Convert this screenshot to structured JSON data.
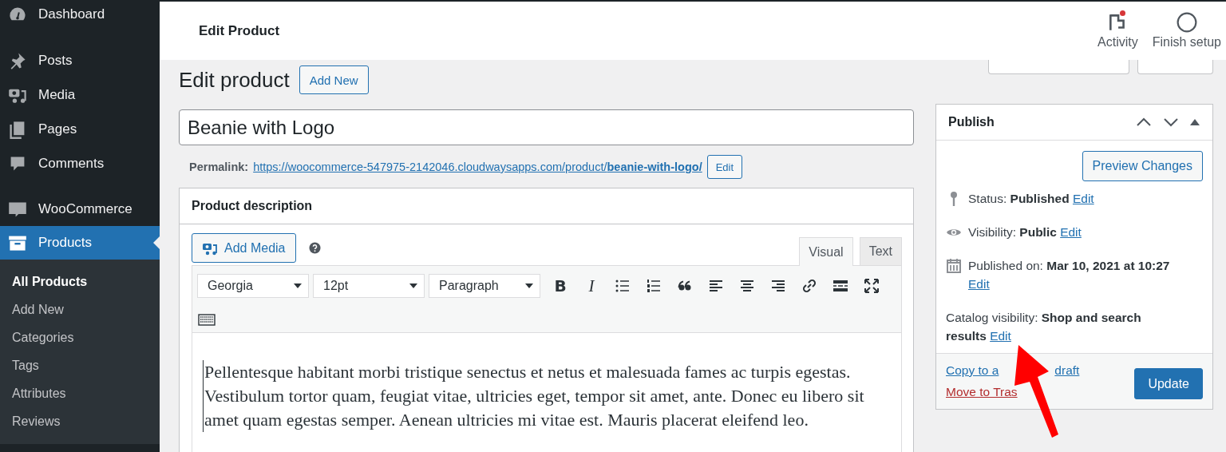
{
  "sidebar": {
    "items": [
      {
        "label": "Dashboard",
        "kind": "dashboard",
        "selected": false
      },
      {
        "label": "Posts",
        "kind": "posts",
        "selected": false
      },
      {
        "label": "Media",
        "kind": "media",
        "selected": false
      },
      {
        "label": "Pages",
        "kind": "pages",
        "selected": false
      },
      {
        "label": "Comments",
        "kind": "comments",
        "selected": false
      },
      {
        "label": "WooCommerce",
        "kind": "woo",
        "selected": false
      },
      {
        "label": "Products",
        "kind": "products",
        "selected": true,
        "children": [
          {
            "label": "All Products",
            "selected": true
          },
          {
            "label": "Add New",
            "selected": false
          },
          {
            "label": "Categories",
            "selected": false
          },
          {
            "label": "Tags",
            "selected": false
          },
          {
            "label": "Attributes",
            "selected": false
          },
          {
            "label": "Reviews",
            "selected": false
          }
        ]
      }
    ]
  },
  "header": {
    "title": "Edit Product",
    "actions": [
      {
        "label": "Activity",
        "kind": "flag",
        "notification": true
      },
      {
        "label": "Finish setup",
        "kind": "circle",
        "notification": false
      }
    ]
  },
  "page": {
    "heading": "Edit product",
    "add_new": "Add New"
  },
  "title_field": {
    "value": "Beanie with Logo"
  },
  "permalink": {
    "label": "Permalink:",
    "url": "https://woocommerce-547975-2142046.cloudwaysapps.com/product/**beanie-with-logo/**",
    "edit": "Edit"
  },
  "description": {
    "title": "Product description",
    "add_media": "Add Media",
    "tabs": [
      {
        "label": "Visual",
        "selected": true
      },
      {
        "label": "Text",
        "selected": false
      }
    ],
    "selects": [
      "Georgia",
      "12pt",
      "Paragraph"
    ],
    "tools": [
      {
        "kind": "bold",
        "text": "B"
      },
      {
        "kind": "italic",
        "text": "I"
      },
      {
        "kind": "bullets"
      },
      {
        "kind": "numbers"
      },
      {
        "kind": "quote"
      },
      {
        "kind": "align-left"
      },
      {
        "kind": "align-center"
      },
      {
        "kind": "align-right"
      },
      {
        "kind": "link"
      },
      {
        "kind": "more"
      },
      {
        "kind": "fullscreen"
      },
      {
        "kind": "keyboard"
      }
    ],
    "content": "Pellentesque habitant morbi tristique senectus et netus et malesuada fames ac turpis egestas. Vestibulum tortor quam, feugiat vitae, ultricies eget, tempor sit amet, ante. Donec eu libero sit amet quam egestas semper. Aenean ultricies mi vitae est. Mauris placerat eleifend leo."
  },
  "publish": {
    "title": "Publish",
    "preview": "Preview Changes",
    "rows": [
      {
        "kind": "status",
        "text": "Status: **Published**",
        "edit": "Edit"
      },
      {
        "kind": "visibility",
        "text": "Visibility: **Public**",
        "edit": "Edit"
      },
      {
        "kind": "date",
        "text": "Published on: **Mar 10, 2021 at 10:27**",
        "edit": "Edit"
      },
      {
        "kind": "catalog",
        "text": "Catalog visibility: **Shop and search results**",
        "edit": "Edit"
      }
    ],
    "copy_parts": [
      "Copy to a",
      "draft"
    ],
    "trash": "Move to Tras",
    "update": "Update"
  }
}
